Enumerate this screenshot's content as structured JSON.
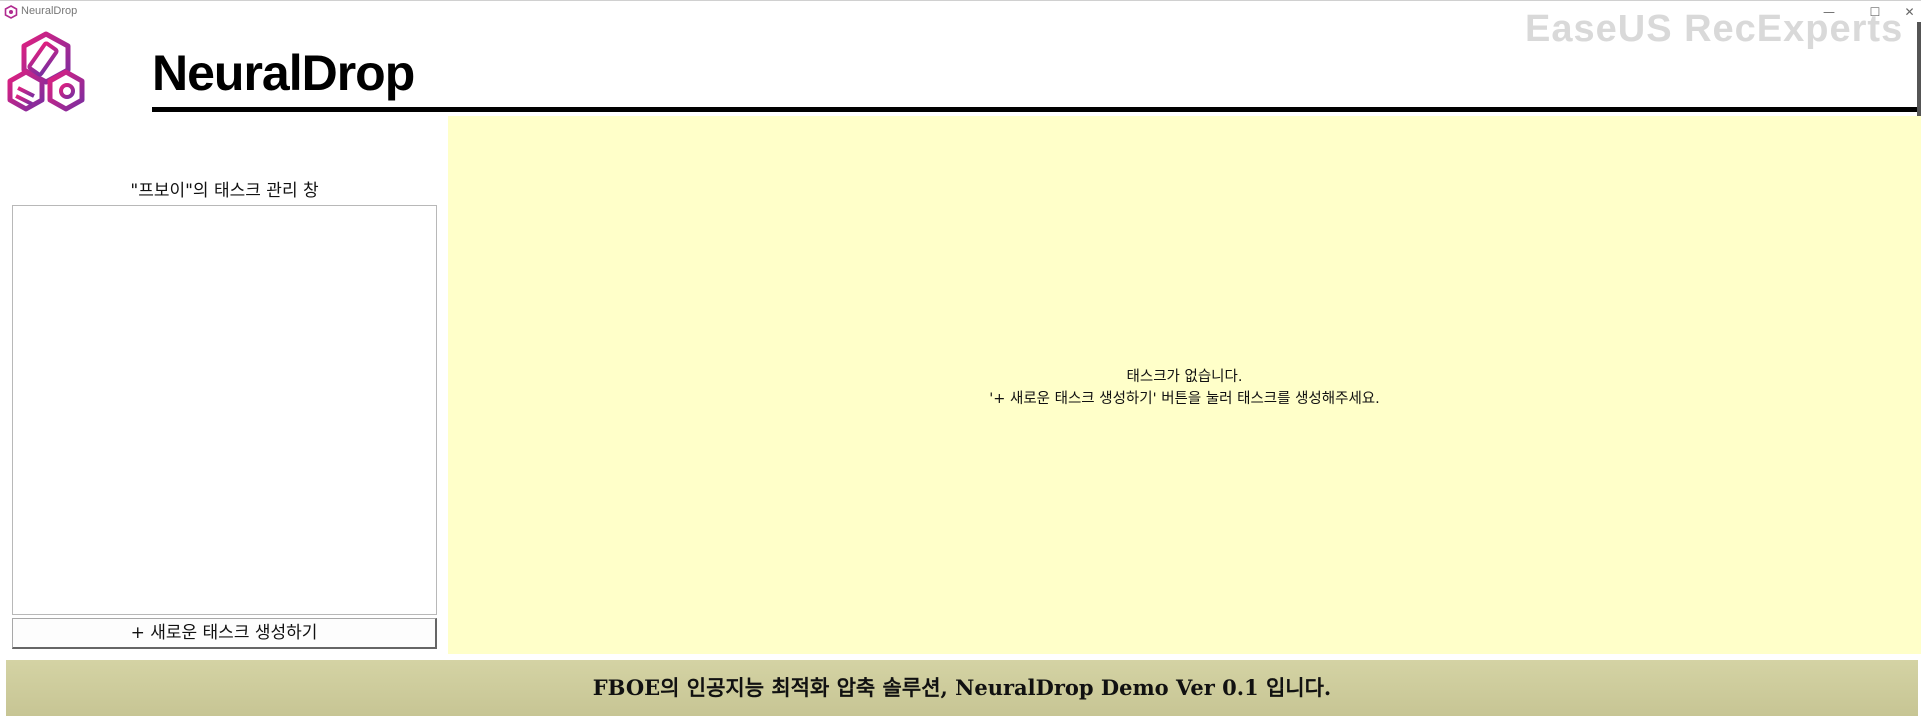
{
  "window": {
    "title": "NeuralDrop",
    "minimize": "—",
    "maximize": "☐",
    "close": "✕"
  },
  "watermark": "EaseUS RecExperts",
  "header": {
    "app_name": "NeuralDrop"
  },
  "sidebar": {
    "panel_title": "\"프보이\"의 태스크 관리 창",
    "create_button_label": "+ 새로운 태스크 생성하기",
    "tasks": []
  },
  "main": {
    "empty_line1": "태스크가 없습니다.",
    "empty_line2": "'+ 새로운 태스크 생성하기' 버튼을 눌러 태스크를 생성해주세요."
  },
  "footer": {
    "text": "FBOE의 인공지능 최적화 압축 솔루션, NeuralDrop Demo Ver 0.1 입니다."
  },
  "colors": {
    "main_bg": "#ffffc9",
    "footer_bg": "#cfcd9c",
    "logo_gradient_start": "#e0207f",
    "logo_gradient_end": "#7a2ea0"
  }
}
